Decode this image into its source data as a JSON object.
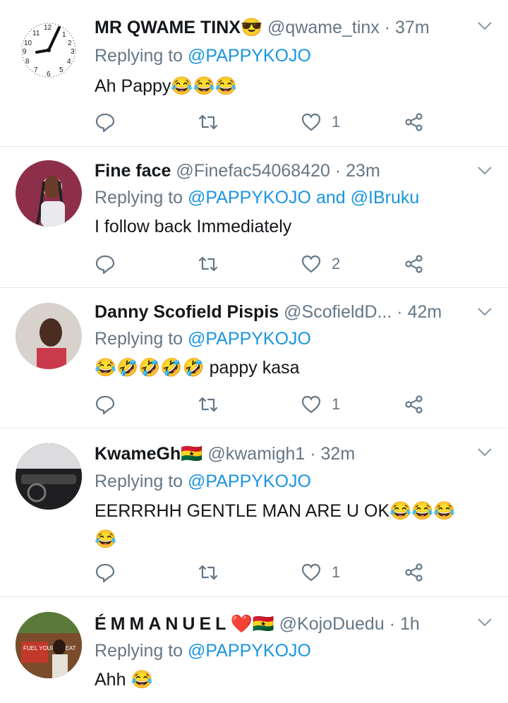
{
  "tweets": [
    {
      "name": "MR QWAME TINX",
      "name_emoji": "😎",
      "handle": "@qwame_tinx",
      "time": "37m",
      "reply_prefix": "Replying to",
      "mention1": "@PAPPYKOJO",
      "mention_join": "",
      "mention2": "",
      "text": "Ah Pappy",
      "text_emojis": [
        "😂",
        "😂",
        "😂"
      ],
      "text_after": "",
      "likes": "1"
    },
    {
      "name": "Fine face",
      "name_emoji": "",
      "handle": "@Finefac54068420",
      "time": "23m",
      "reply_prefix": "Replying to",
      "mention1": "@PAPPYKOJO",
      "mention_join": "and",
      "mention2": "@IBruku",
      "text": "I follow back Immediately",
      "text_emojis": [],
      "text_after": "",
      "likes": "2"
    },
    {
      "name": "Danny Scofield Pispis",
      "name_emoji": "",
      "handle": "@ScofieldD...",
      "time": "42m",
      "reply_prefix": "Replying to",
      "mention1": "@PAPPYKOJO",
      "mention_join": "",
      "mention2": "",
      "text": "",
      "text_emojis": [
        "😂",
        "🤣",
        "🤣",
        "🤣",
        "🤣"
      ],
      "text_after": " pappy kasa",
      "likes": "1"
    },
    {
      "name": "KwameGh",
      "name_emoji": "🇬🇭",
      "handle": "@kwamigh1",
      "time": "32m",
      "reply_prefix": "Replying to",
      "mention1": "@PAPPYKOJO",
      "mention_join": "",
      "mention2": "",
      "text": "EERRRHH GENTLE MAN ARE U OK",
      "text_emojis": [
        "😂",
        "😂",
        "😂",
        "😂"
      ],
      "text_after": "",
      "likes": "1"
    },
    {
      "name": "ÉMMANUEL",
      "name_emoji": "❤️🇬🇭",
      "handle": "@KojoDuedu",
      "time": "1h",
      "reply_prefix": "Replying to",
      "mention1": "@PAPPYKOJO",
      "mention_join": "",
      "mention2": "",
      "text": "Ahh",
      "text_emojis": [
        "😂"
      ],
      "text_after": "",
      "likes": ""
    }
  ],
  "avatar5_text": "FUEL YOUR GREAT",
  "colors": {
    "link": "#1b95e0",
    "muted": "#657786",
    "divider": "#e1e8ed",
    "emoji": "#f7c52c"
  },
  "icons": [
    "reply-icon",
    "retweet-icon",
    "like-icon",
    "share-icon",
    "chevron-down-icon",
    "clock-icon"
  ]
}
